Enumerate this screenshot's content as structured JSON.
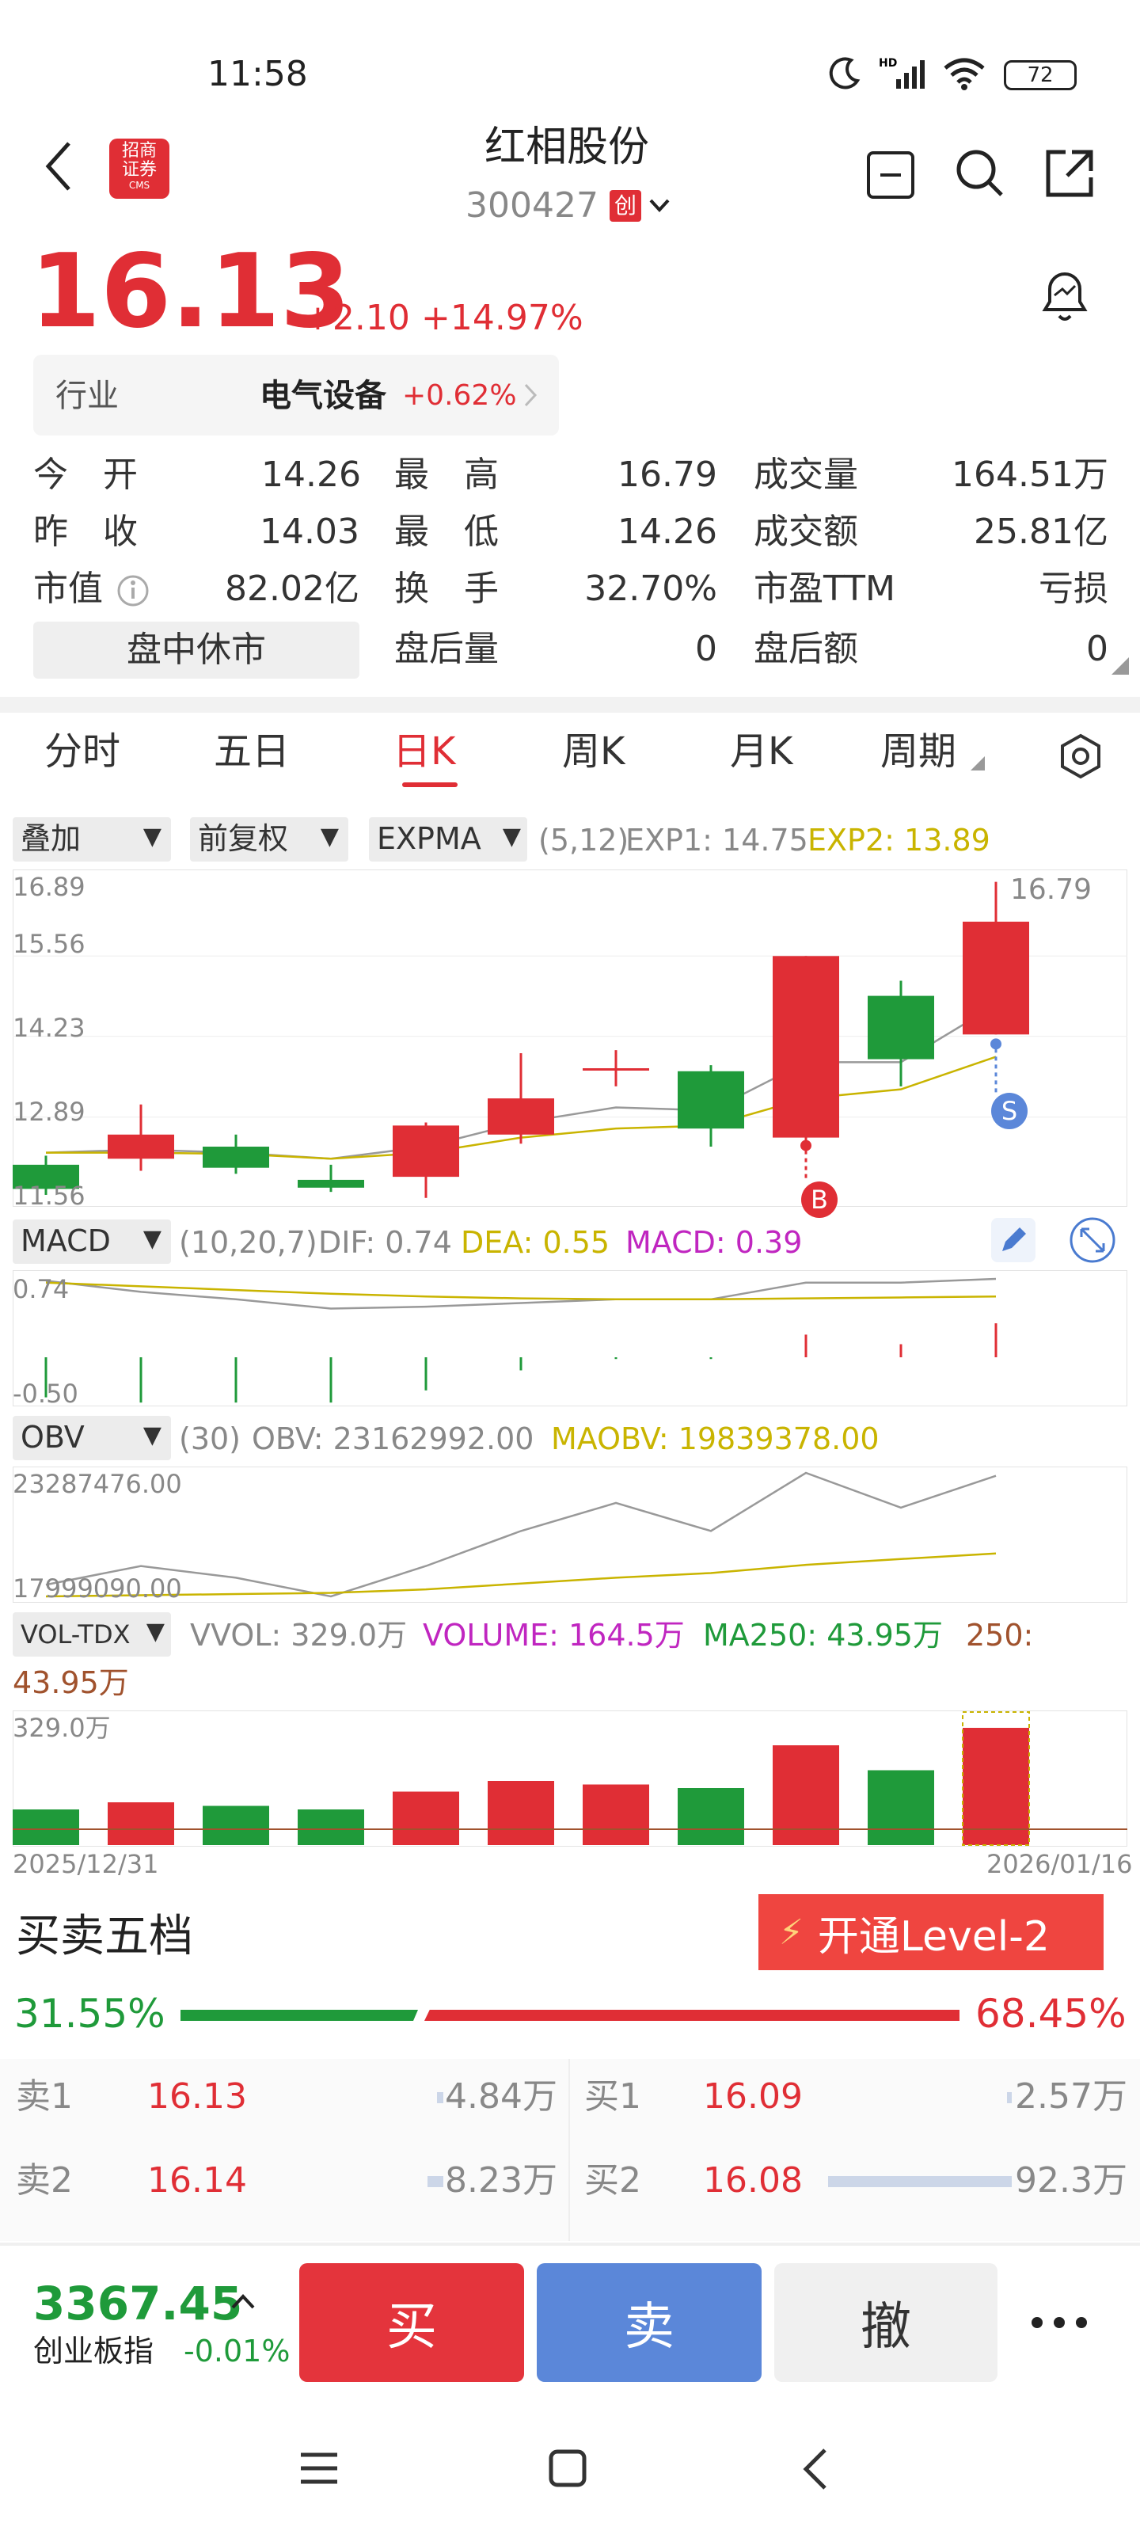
{
  "status_bar": {
    "time": "11:58",
    "battery": "72"
  },
  "header": {
    "broker_line1": "招商",
    "broker_line2": "证券",
    "broker_sub": "CMS",
    "title": "红相股份",
    "code": "300427",
    "board_badge": "创"
  },
  "quote": {
    "price": "16.13",
    "change": "+2.10",
    "change_pct": "+14.97%"
  },
  "industry": {
    "label": "行业",
    "name": "电气设备",
    "change": "+0.62%"
  },
  "stats": {
    "open_label": "今　开",
    "open": "14.26",
    "high_label": "最　高",
    "high": "16.79",
    "volume_label": "成交量",
    "volume": "164.51万",
    "prev_close_label": "昨　收",
    "prev_close": "14.03",
    "low_label": "最　低",
    "low": "14.26",
    "turnover_amount_label": "成交额",
    "turnover_amount": "25.81亿",
    "mktcap_label": "市值",
    "mktcap": "82.02亿",
    "turnover_rate_label": "换　手",
    "turnover_rate": "32.70%",
    "pe_label": "市盈TTM",
    "pe": "亏损",
    "session_status": "盘中休市",
    "after_vol_label": "盘后量",
    "after_vol": "0",
    "after_amt_label": "盘后额",
    "after_amt": "0"
  },
  "period_tabs": [
    "分时",
    "五日",
    "日K",
    "周K",
    "月K",
    "周期"
  ],
  "active_tab": "日K",
  "kline": {
    "overlay_dropdown": "叠加",
    "adjust_dropdown": "前复权",
    "indicator_dropdown": "EXPMA",
    "params": "(5,12)",
    "exp1": "EXP1: 14.75",
    "exp2": "EXP2: 13.89",
    "y_labels": [
      "16.89",
      "15.56",
      "14.23",
      "12.89",
      "11.56"
    ],
    "high_marker": "16.79",
    "buy_marker": "B",
    "sell_marker": "S"
  },
  "macd": {
    "dropdown": "MACD",
    "params": "(10,20,7)",
    "dif": "DIF: 0.74",
    "dea": "DEA: 0.55",
    "macd": "MACD: 0.39",
    "y_top": "0.74",
    "y_bottom": "-0.50"
  },
  "obv": {
    "dropdown": "OBV",
    "params": "(30)",
    "obv": "OBV: 23162992.00",
    "maobv": "MAOBV: 19839378.00",
    "y_top": "23287476.00",
    "y_bottom": "17999090.00"
  },
  "vol": {
    "dropdown": "VOL-TDX",
    "vvol": "VVOL: 329.0万",
    "volume": "VOLUME: 164.5万",
    "ma250": "MA250: 43.95万",
    "extra_1": "250:",
    "extra_2": "43.95万",
    "y_top": "329.0万",
    "date_start": "2025/12/31",
    "date_end": "2026/01/16"
  },
  "chart_data": {
    "type": "candlestick",
    "dates": [
      "2025/12/31",
      "",
      "",
      "",
      "",
      "",
      "",
      "",
      "",
      "",
      "2026/01/16"
    ],
    "candles": [
      {
        "open": 12.1,
        "close": 11.7,
        "high": 12.25,
        "low": 11.6
      },
      {
        "open": 12.2,
        "close": 12.6,
        "high": 13.1,
        "low": 12.0
      },
      {
        "open": 12.4,
        "close": 12.05,
        "high": 12.6,
        "low": 11.95
      },
      {
        "open": 11.85,
        "close": 11.72,
        "high": 12.1,
        "low": 11.65
      },
      {
        "open": 11.9,
        "close": 12.75,
        "high": 12.8,
        "low": 11.55
      },
      {
        "open": 12.6,
        "close": 13.2,
        "high": 13.95,
        "low": 12.45
      },
      {
        "open": 13.7,
        "close": 13.7,
        "high": 14.0,
        "low": 13.4
      },
      {
        "open": 13.65,
        "close": 12.7,
        "high": 13.75,
        "low": 12.4
      },
      {
        "open": 12.55,
        "close": 15.56,
        "high": 15.56,
        "low": 12.3
      },
      {
        "open": 14.9,
        "close": 13.85,
        "high": 15.15,
        "low": 13.4
      },
      {
        "open": 14.26,
        "close": 16.13,
        "high": 16.79,
        "low": 14.26
      }
    ],
    "exp1": [
      12.3,
      12.35,
      12.3,
      12.2,
      12.4,
      12.8,
      13.05,
      13.0,
      13.8,
      13.8,
      14.75
    ],
    "exp2": [
      12.3,
      12.3,
      12.28,
      12.2,
      12.3,
      12.55,
      12.7,
      12.75,
      13.2,
      13.35,
      13.89
    ],
    "macd_bars": [
      -0.46,
      -0.52,
      -0.52,
      -0.52,
      -0.38,
      -0.15,
      -0.02,
      -0.02,
      0.26,
      0.15,
      0.39
    ],
    "dif": [
      0.72,
      0.6,
      0.52,
      0.42,
      0.44,
      0.48,
      0.52,
      0.52,
      0.7,
      0.7,
      0.74
    ],
    "dea": [
      0.7,
      0.66,
      0.62,
      0.58,
      0.55,
      0.53,
      0.52,
      0.52,
      0.53,
      0.54,
      0.55
    ],
    "obv": [
      18500000,
      19300000,
      18800000,
      18000000,
      19300000,
      20800000,
      22000000,
      20800000,
      23287476,
      21800000,
      23162992
    ],
    "maobv": [
      17999090,
      18050000,
      18100000,
      18150000,
      18300000,
      18550000,
      18800000,
      19000000,
      19350000,
      19600000,
      19839378
    ],
    "volume": [
      50,
      60,
      55,
      50,
      75,
      90,
      85,
      80,
      140,
      105,
      164.5
    ],
    "volume_unit": "万",
    "ylim": [
      11.56,
      16.89
    ]
  },
  "order_book": {
    "title": "买卖五档",
    "level2_button": "开通Level-2",
    "buy_ratio": "31.55%",
    "sell_ratio": "68.45%",
    "asks": [
      {
        "label": "卖1",
        "price": "16.13",
        "volume": "4.84万"
      },
      {
        "label": "卖2",
        "price": "16.14",
        "volume": "8.23万"
      }
    ],
    "bids": [
      {
        "label": "买1",
        "price": "16.09",
        "volume": "2.57万"
      },
      {
        "label": "买2",
        "price": "16.08",
        "volume": "92.3万"
      }
    ]
  },
  "bottom_bar": {
    "index_value": "3367.45",
    "index_name": "创业板指",
    "index_change": "-0.01%",
    "buy": "买",
    "sell": "卖",
    "cancel": "撤"
  },
  "colors": {
    "up": "#e02e35",
    "down": "#1f9a3a",
    "exp1": "#999999",
    "exp2": "#c9b400",
    "sell_btn": "#5b87d9"
  }
}
